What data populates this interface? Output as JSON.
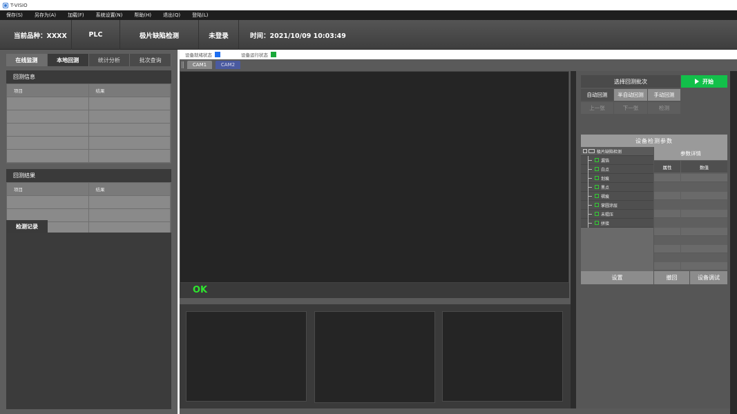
{
  "app": {
    "title": "T-VISIO"
  },
  "menu": [
    "保存(S)",
    "另存为(A)",
    "加载(F)",
    "系统设置(N)",
    "帮助(H)",
    "退出(Q)",
    "登陆(L)"
  ],
  "header": {
    "product": "当前品种：XXXX",
    "plc": "PLC",
    "mode": "极片缺陷检测",
    "login": "未登录",
    "time": "时间：2021/10/09 10:03:49"
  },
  "left_tabs": [
    "在线监测",
    "本地回测",
    "统计分析",
    "批次查询"
  ],
  "replay_info": {
    "title": "回测信息",
    "col_item": "项目",
    "col_result": "结果"
  },
  "replay_result": {
    "title": "回测结果",
    "col_item": "项目",
    "col_result": "结果"
  },
  "record": {
    "title": "检测记录"
  },
  "status": {
    "ready_label": "设备就绪状态",
    "ready_color": "#1e6ef0",
    "run_label": "设备运行状态",
    "run_color": "#1aa83a"
  },
  "cams": [
    "CAM1",
    "CAM2"
  ],
  "result": {
    "text": "OK",
    "color": "#2ee62e"
  },
  "controls": {
    "select_batch": "选择回测批次",
    "start": "开始",
    "auto": "自动回测",
    "semi": "半自动回测",
    "manual": "手动回测",
    "prev": "上一张",
    "next": "下一张",
    "detect": "检测"
  },
  "params": {
    "title": "设备检测参数",
    "root": "极片缺陷检测",
    "items": [
      "漏箔",
      "白点",
      "划痕",
      "黑点",
      "褶痕",
      "掌圆涂层",
      "未辊压",
      "拼接"
    ],
    "detail_title": "参数详情",
    "col_attr": "属性",
    "col_value": "数值"
  },
  "bottom": {
    "settings": "设置",
    "undo": "撤回",
    "debug": "设备调试"
  }
}
